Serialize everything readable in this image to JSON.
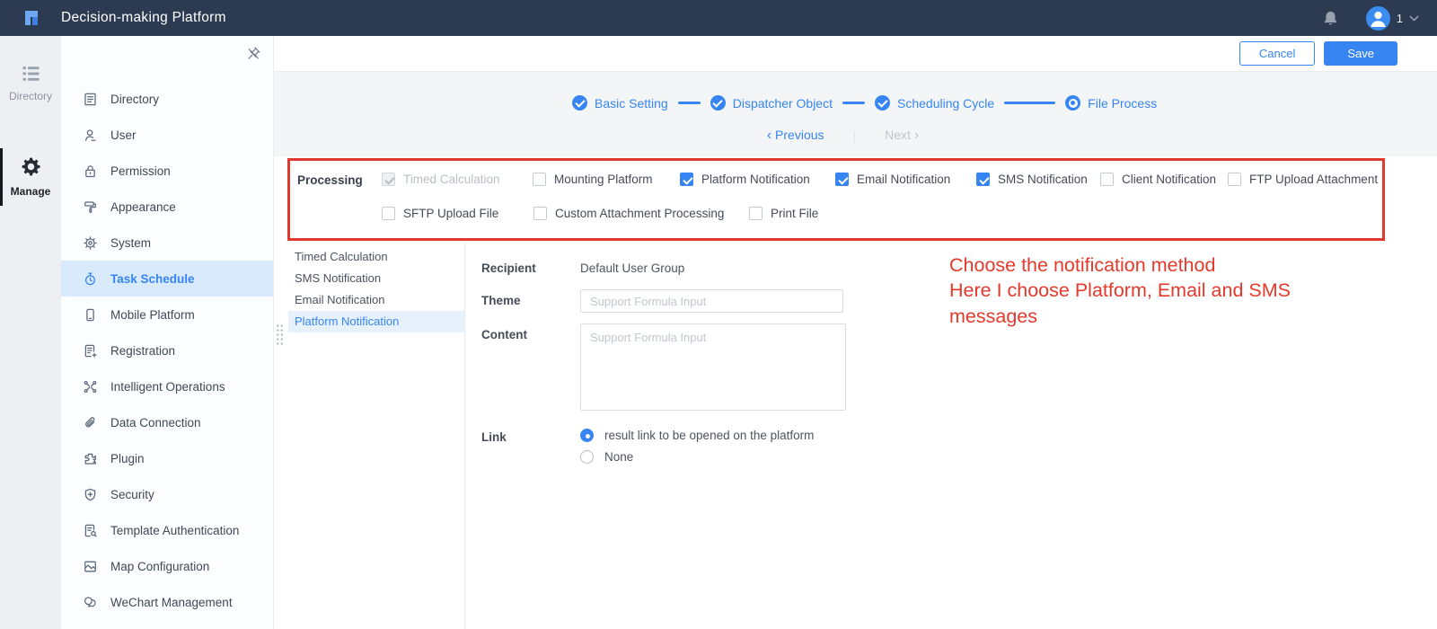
{
  "colors": {
    "accent": "#3685f2",
    "header_bg": "#2d3b52",
    "annotation_red": "#e03a2e",
    "sidebar_active_bg": "#d9eafc"
  },
  "header": {
    "title": "Decision-making Platform",
    "user_count": "1"
  },
  "rail": {
    "items": [
      {
        "label": "Directory",
        "icon": "list-icon",
        "active": false
      },
      {
        "label": "Manage",
        "icon": "gear-icon",
        "active": true
      }
    ]
  },
  "sidebar": {
    "pin_icon": "pin-slash-icon",
    "items": [
      {
        "label": "Directory",
        "icon": "document-icon",
        "active": false
      },
      {
        "label": "User",
        "icon": "user-icon",
        "active": false
      },
      {
        "label": "Permission",
        "icon": "lock-icon",
        "active": false
      },
      {
        "label": "Appearance",
        "icon": "paint-roller-icon",
        "active": false
      },
      {
        "label": "System",
        "icon": "gear-icon",
        "active": false
      },
      {
        "label": "Task Schedule",
        "icon": "stopwatch-icon",
        "active": true
      },
      {
        "label": "Mobile Platform",
        "icon": "phone-icon",
        "active": false
      },
      {
        "label": "Registration",
        "icon": "document-plus-icon",
        "active": false
      },
      {
        "label": "Intelligent Operations",
        "icon": "nodes-icon",
        "active": false
      },
      {
        "label": "Data Connection",
        "icon": "paperclip-icon",
        "active": false
      },
      {
        "label": "Plugin",
        "icon": "puzzle-icon",
        "active": false
      },
      {
        "label": "Security",
        "icon": "shield-plus-icon",
        "active": false
      },
      {
        "label": "Template Authentication",
        "icon": "document-search-icon",
        "active": false
      },
      {
        "label": "Map Configuration",
        "icon": "image-icon",
        "active": false
      },
      {
        "label": "WeChart Management",
        "icon": "chat-bubbles-icon",
        "active": false
      }
    ]
  },
  "toolbar": {
    "cancel_label": "Cancel",
    "save_label": "Save"
  },
  "stepper": {
    "steps": [
      {
        "label": "Basic Setting",
        "done": true,
        "current": false
      },
      {
        "label": "Dispatcher Object",
        "done": true,
        "current": false
      },
      {
        "label": "Scheduling Cycle",
        "done": true,
        "current": false
      },
      {
        "label": "File Process",
        "done": false,
        "current": true
      }
    ],
    "previous_label": "Previous",
    "next_label": "Next",
    "prev_arrow": "‹",
    "next_arrow": "›",
    "separator": "|"
  },
  "processing": {
    "label": "Processing",
    "options": [
      {
        "label": "Timed Calculation",
        "checked": true,
        "disabled": true
      },
      {
        "label": "Mounting Platform",
        "checked": false,
        "disabled": false
      },
      {
        "label": "Platform Notification",
        "checked": true,
        "disabled": false
      },
      {
        "label": "Email Notification",
        "checked": true,
        "disabled": false
      },
      {
        "label": "SMS Notification",
        "checked": true,
        "disabled": false
      },
      {
        "label": "Client Notification",
        "checked": false,
        "disabled": false
      },
      {
        "label": "FTP Upload Attachment",
        "checked": false,
        "disabled": false
      },
      {
        "label": "SFTP Upload File",
        "checked": false,
        "disabled": false
      },
      {
        "label": "Custom Attachment Processing",
        "checked": false,
        "disabled": false
      },
      {
        "label": "Print File",
        "checked": false,
        "disabled": false
      }
    ]
  },
  "subtabs": {
    "items": [
      {
        "label": "Timed Calculation",
        "active": false
      },
      {
        "label": "SMS Notification",
        "active": false
      },
      {
        "label": "Email Notification",
        "active": false
      },
      {
        "label": "Platform Notification",
        "active": true
      }
    ]
  },
  "form": {
    "recipient_label": "Recipient",
    "recipient_value": "Default User Group",
    "theme_label": "Theme",
    "theme_placeholder": "Support Formula Input",
    "theme_value": "",
    "content_label": "Content",
    "content_placeholder": "Support Formula Input",
    "content_value": "",
    "link_label": "Link",
    "link_options": [
      {
        "label": "result link to be opened on the platform",
        "selected": true
      },
      {
        "label": "None",
        "selected": false
      }
    ]
  },
  "annotation": {
    "lines": [
      "Choose the notification method",
      "Here I choose Platform, Email and SMS",
      "messages"
    ]
  }
}
